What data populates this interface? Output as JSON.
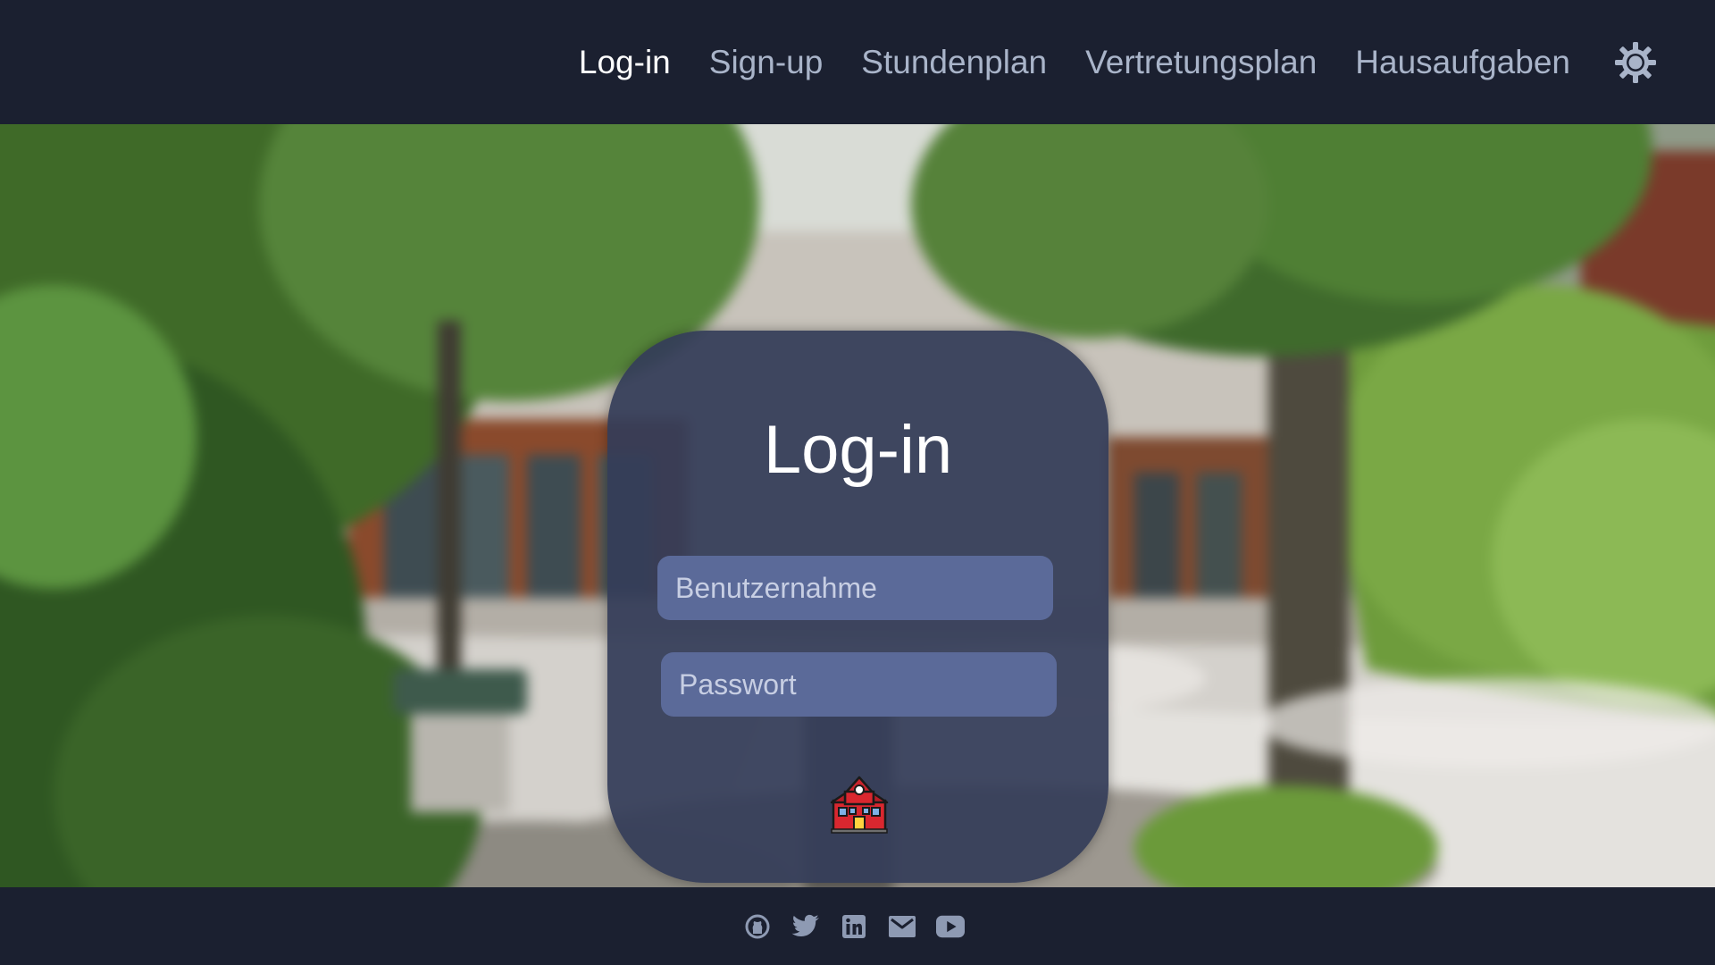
{
  "nav": {
    "items": [
      {
        "label": "Log-in",
        "active": true
      },
      {
        "label": "Sign-up",
        "active": false
      },
      {
        "label": "Stundenplan",
        "active": false
      },
      {
        "label": "Vertretungsplan",
        "active": false
      },
      {
        "label": "Hausaufgaben",
        "active": false
      }
    ],
    "theme_icon": "sun-icon"
  },
  "login": {
    "title": "Log-in",
    "username_placeholder": "Benutzernahme",
    "password_placeholder": "Passwort",
    "submit_icon": "school-icon"
  },
  "footer": {
    "icons": [
      "github-icon",
      "twitter-icon",
      "linkedin-icon",
      "mail-icon",
      "youtube-icon"
    ]
  },
  "colors": {
    "background": "#1b2030",
    "card": "#343c58",
    "input": "#5b6a99",
    "nav_inactive": "#a9b4c9",
    "nav_active": "#ffffff",
    "footer_icon": "#8e9ab3"
  }
}
